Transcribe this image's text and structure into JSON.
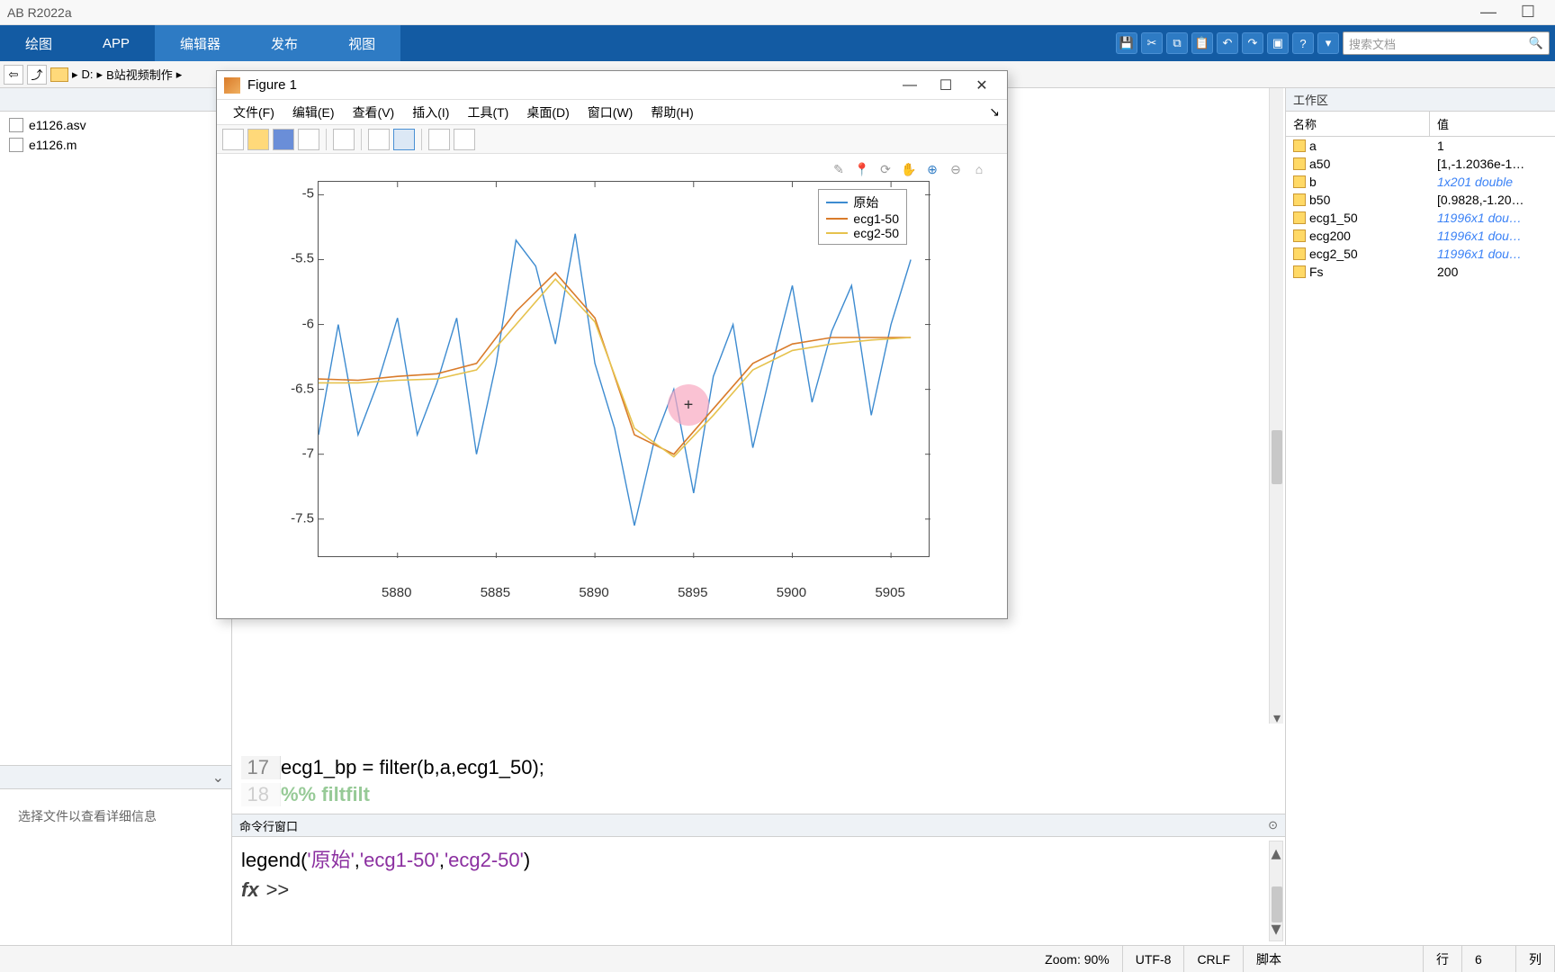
{
  "title": "AB R2022a",
  "toolstrip": {
    "tabs": [
      "绘图",
      "APP",
      "编辑器",
      "发布",
      "视图"
    ],
    "search_ph": "搜索文档"
  },
  "pathbar": {
    "drive": "D:",
    "folder": "B站视频制作"
  },
  "left": {
    "header": "",
    "col": "",
    "files": [
      "e1126.asv",
      "e1126.m"
    ],
    "details_note": "选择文件以查看详细信息"
  },
  "editor": {
    "line_no": "17",
    "line_no2": "18",
    "code": "ecg1_bp = filter(b,a,ecg1_50);",
    "code2": "%% filtfilt"
  },
  "cmdwin": {
    "header": "命令行窗口",
    "line": "legend('原始','ecg1-50','ecg2-50')",
    "prompt": ">>"
  },
  "workspace": {
    "title": "工作区",
    "cols": [
      "名称",
      "值"
    ],
    "rows": [
      {
        "n": "a",
        "v": "1"
      },
      {
        "n": "a50",
        "v": "[1,-1.2036e-1…"
      },
      {
        "n": "b",
        "v": "1x201 double",
        "it": true
      },
      {
        "n": "b50",
        "v": "[0.9828,-1.20…"
      },
      {
        "n": "ecg1_50",
        "v": "11996x1 dou…",
        "it": true
      },
      {
        "n": "ecg200",
        "v": "11996x1 dou…",
        "it": true
      },
      {
        "n": "ecg2_50",
        "v": "11996x1 dou…",
        "it": true
      },
      {
        "n": "Fs",
        "v": "200"
      }
    ]
  },
  "status": {
    "zoom": "Zoom: 90%",
    "enc": "UTF-8",
    "eol": "CRLF",
    "type": "脚本",
    "row": "行",
    "rown": "6",
    "col": "列"
  },
  "figure": {
    "title": "Figure 1",
    "menus": [
      "文件(F)",
      "编辑(E)",
      "查看(V)",
      "插入(I)",
      "工具(T)",
      "桌面(D)",
      "窗口(W)",
      "帮助(H)"
    ],
    "legend": [
      "原始",
      "ecg1-50",
      "ecg2-50"
    ]
  },
  "chart_data": {
    "type": "line",
    "xlabel": "",
    "ylabel": "",
    "xlim": [
      5876,
      5907
    ],
    "ylim": [
      -7.8,
      -4.9
    ],
    "xticks": [
      5880,
      5885,
      5890,
      5895,
      5900,
      5905
    ],
    "yticks": [
      -5,
      -5.5,
      -6,
      -6.5,
      -7,
      -7.5
    ],
    "legend": [
      "原始",
      "ecg1-50",
      "ecg2-50"
    ],
    "series": [
      {
        "name": "原始",
        "color": "#3d8bd0",
        "x": [
          5876,
          5877,
          5878,
          5879,
          5880,
          5881,
          5882,
          5883,
          5884,
          5885,
          5886,
          5887,
          5888,
          5889,
          5890,
          5891,
          5892,
          5893,
          5894,
          5895,
          5896,
          5897,
          5898,
          5899,
          5900,
          5901,
          5902,
          5903,
          5904,
          5905,
          5906
        ],
        "y": [
          -6.85,
          -6.0,
          -6.85,
          -6.45,
          -5.95,
          -6.85,
          -6.45,
          -5.95,
          -7.0,
          -6.3,
          -5.35,
          -5.55,
          -6.15,
          -5.3,
          -6.3,
          -6.8,
          -7.55,
          -6.9,
          -6.5,
          -7.3,
          -6.4,
          -6.0,
          -6.95,
          -6.3,
          -5.7,
          -6.6,
          -6.05,
          -5.7,
          -6.7,
          -6.0,
          -5.5
        ]
      },
      {
        "name": "ecg1-50",
        "color": "#d97b2a",
        "x": [
          5876,
          5878,
          5880,
          5882,
          5884,
          5886,
          5888,
          5890,
          5892,
          5894,
          5896,
          5898,
          5900,
          5902,
          5904,
          5906
        ],
        "y": [
          -6.42,
          -6.43,
          -6.4,
          -6.38,
          -6.3,
          -5.9,
          -5.6,
          -5.95,
          -6.85,
          -7.0,
          -6.65,
          -6.3,
          -6.15,
          -6.1,
          -6.1,
          -6.1
        ]
      },
      {
        "name": "ecg2-50",
        "color": "#e6c24d",
        "x": [
          5876,
          5878,
          5880,
          5882,
          5884,
          5886,
          5888,
          5890,
          5892,
          5894,
          5896,
          5898,
          5900,
          5902,
          5904,
          5906
        ],
        "y": [
          -6.45,
          -6.45,
          -6.43,
          -6.42,
          -6.35,
          -6.0,
          -5.65,
          -5.98,
          -6.8,
          -7.02,
          -6.7,
          -6.35,
          -6.2,
          -6.15,
          -6.12,
          -6.1
        ]
      }
    ]
  }
}
